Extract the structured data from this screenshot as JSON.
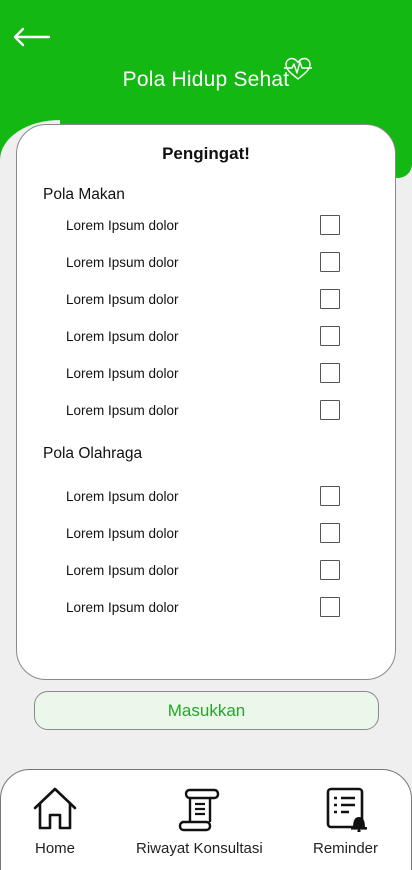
{
  "header": {
    "back_icon": "arrow-left-icon",
    "title": "Pola Hidup Sehat",
    "title_icon": "heartbeat-icon",
    "color": "#13b813"
  },
  "card": {
    "title": "Pengingat!",
    "sections": [
      {
        "title": "Pola Makan",
        "items": [
          {
            "label": "Lorem Ipsum dolor",
            "checked": false
          },
          {
            "label": "Lorem Ipsum dolor",
            "checked": false
          },
          {
            "label": "Lorem Ipsum dolor",
            "checked": false
          },
          {
            "label": "Lorem Ipsum dolor",
            "checked": false
          },
          {
            "label": "Lorem Ipsum dolor",
            "checked": false
          },
          {
            "label": "Lorem Ipsum dolor",
            "checked": false
          }
        ]
      },
      {
        "title": "Pola Olahraga",
        "items": [
          {
            "label": "Lorem Ipsum dolor",
            "checked": false
          },
          {
            "label": "Lorem Ipsum dolor",
            "checked": false
          },
          {
            "label": "Lorem Ipsum dolor",
            "checked": false
          },
          {
            "label": "Lorem Ipsum dolor",
            "checked": false
          }
        ]
      }
    ]
  },
  "submit_label": "Masukkan",
  "nav": {
    "items": [
      {
        "label": "Home",
        "icon": "home-icon"
      },
      {
        "label": "Riwayat Konsultasi",
        "icon": "scroll-icon"
      },
      {
        "label": "Reminder",
        "icon": "reminder-list-bell-icon"
      }
    ]
  }
}
